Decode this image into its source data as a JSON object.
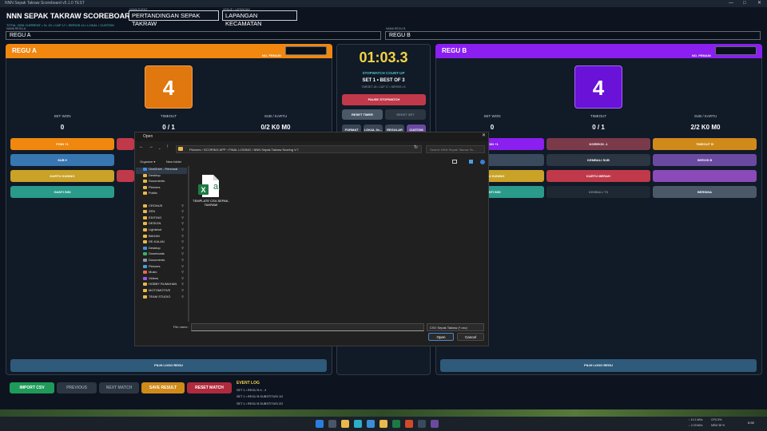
{
  "window": {
    "title": "NNN Sepak Takraw Scoreboard v5.1.0 TEST"
  },
  "app": {
    "title": "NNN SEPAK TAKRAW SCOREBOARD",
    "subinfo": "TOTAL 2026 CURRENT • 3× 15 • CAP 17 • SERVIS x3 • LOKAL / CUSTOM",
    "event_label": "NAMA EVENT",
    "event_value": "PERTANDINGAN SEPAK TAKRAW",
    "venue_label": "VENUE / LAPANGAN",
    "venue_value": "LAPANGAN KECAMATAN",
    "team_a_label": "NAMA REGU A",
    "team_a_value": "REGU A",
    "team_b_label": "NAMA REGU B",
    "team_b_value": "REGU B"
  },
  "team_a": {
    "name": "REGU A",
    "no_pemain": "NO. PEMAIN",
    "score": "4",
    "set_won_label": "SET WON",
    "set_won": "0",
    "timeout_label": "TIMEOUT",
    "timeout": "0 / 1",
    "sub_label": "SUB / KARTU",
    "sub": "0/2  K0 M0",
    "btn_poin": "POIN +1",
    "btn_sub": "SUB ▾",
    "btn_kartu_kuning": "KARTU KUNING",
    "btn_ganti_sisi": "GANTI SISI",
    "btn_logo": "PILIH LOGO REGU"
  },
  "team_b": {
    "name": "REGU B",
    "no_pemain": "NO. PEMAIN",
    "score": "4",
    "set_won_label": "SET WON",
    "set_won": "0",
    "timeout_label": "TIMEOUT",
    "timeout": "0 / 1",
    "sub_label": "SUB / KARTU",
    "sub": "2/2  K0 M0",
    "btn_poin": "POIN +1",
    "btn_koreksi": "KOREKSI -1",
    "btn_timeout": "TIMEOUT B",
    "btn_kembali_sub": "KEMBALI SUB",
    "btn_servis": "SERVIS B",
    "btn_kartu_kuning": "KARTU KUNING",
    "btn_kartu_merah": "KARTU MERAH",
    "btn_ganti_sisi": "GANTI SISI",
    "btn_kembali_ts": "KEMBALI TS",
    "btn_bersina": "BERSINA",
    "btn_logo": "PILIH LOGO REGU"
  },
  "center": {
    "timer": "01:03.3",
    "stopwatch": "STOPWATCH COUNT-UP",
    "set_info": "SET 1 • BEST OF 3",
    "set_sub": "TARGET 15 • CAP 17 • SERVIS ×3",
    "pause": "PAUSE STOPWATCH",
    "reset_timer": "RESET TIMER",
    "reset_set": "RESET SET",
    "b1": "FORMAT 3×15",
    "b2": "LOKAL 3×...",
    "b3": "REGULAR",
    "b4": "CUSTOM"
  },
  "bottom": {
    "import": "IMPORT CSV",
    "previous": "PREVIOUS",
    "next": "NEXT MATCH",
    "save": "SAVE RESULT",
    "reset": "RESET MATCH",
    "event_log_title": "EVENT LOG",
    "log": [
      "SET 1 • REGU B 4 - 4",
      "SET 1 • REGU B SUBSTITUSI 1/2",
      "SET 1 • REGU B SUBSTITUSI 2/2"
    ]
  },
  "dialog": {
    "title": "Open",
    "address": [
      "Pictures",
      "SCORING APP",
      "FINAL LOGING",
      "NNN Sepak Takraw Scoring V.7"
    ],
    "search_placeholder": "Search NNN Sepak Takraw Sc...",
    "organize": "Organize ▾",
    "new_folder": "New folder",
    "sidebar": [
      {
        "label": "OneDrive - Personal",
        "color": "#3a8ee6"
      },
      {
        "label": "Desktop",
        "color": "#e8b84a"
      },
      {
        "label": "Documents",
        "color": "#e8b84a"
      },
      {
        "label": "Pictures",
        "color": "#e8b84a"
      },
      {
        "label": "Public",
        "color": "#e8b84a"
      },
      {
        "label": "",
        "color": ""
      },
      {
        "label": "CRONUS",
        "color": "#e8b84a"
      },
      {
        "label": "ZEN",
        "color": "#e8b84a"
      },
      {
        "label": "EDITING",
        "color": "#e8b84a"
      },
      {
        "label": "DESIGN",
        "color": "#e8b84a"
      },
      {
        "label": "Lightshot",
        "color": "#e8b84a"
      },
      {
        "label": "BAHAN",
        "color": "#e8b84a"
      },
      {
        "label": "SE-KALAN",
        "color": "#e8b84a"
      },
      {
        "label": "Desktop",
        "color": "#4a8ed6"
      },
      {
        "label": "Downloads",
        "color": "#3ab06e"
      },
      {
        "label": "Documents",
        "color": "#8a9aaa"
      },
      {
        "label": "Pictures",
        "color": "#4a9ee6"
      },
      {
        "label": "Music",
        "color": "#e66a4a"
      },
      {
        "label": "Videos",
        "color": "#9a5ae6"
      },
      {
        "label": "HOBBY RUMAHAN",
        "color": "#e8b84a"
      },
      {
        "label": "MOTOMOTIVE",
        "color": "#e8b84a"
      },
      {
        "label": "TEAM STUDIO",
        "color": "#e8b84a"
      }
    ],
    "file_name": "TEMPLATE CSV-SEPAK-TAKRAW",
    "file_name_label": "File name:",
    "file_type": "CSV Sepak Takraw (*.csv)",
    "open": "Open",
    "cancel": "Cancel"
  },
  "taskbar": {
    "net_up": "↑ 10.1 kB/s",
    "net_down": "↓ 2.29 kB/s",
    "cpu": "CPU 5%",
    "mem": "MEM 38 %",
    "time": "8:58"
  }
}
